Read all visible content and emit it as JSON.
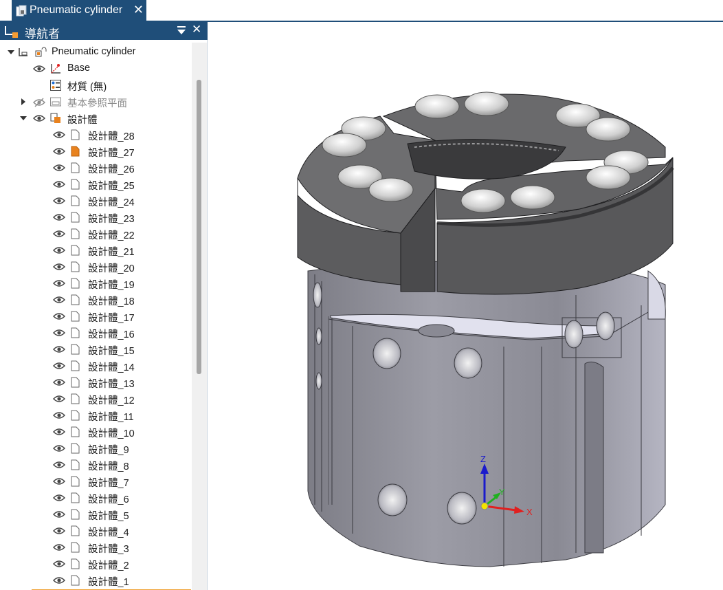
{
  "document_tab": {
    "title": "Pneumatic cylinder",
    "close_glyph": "✕",
    "icon": "part-document-icon"
  },
  "navigator": {
    "title": "導航者",
    "close_glyph": "✕",
    "root": {
      "label": "Pneumatic cylinder"
    },
    "base": {
      "label": "Base"
    },
    "material": {
      "label": "材質 (無)"
    },
    "ref_planes": {
      "label": "基本參照平面"
    },
    "bodies_folder": {
      "label": "設計體"
    },
    "bodies": [
      "設計體_28",
      "設計體_27",
      "設計體_26",
      "設計體_25",
      "設計體_24",
      "設計體_23",
      "設計體_22",
      "設計體_21",
      "設計體_20",
      "設計體_19",
      "設計體_18",
      "設計體_17",
      "設計體_16",
      "設計體_15",
      "設計體_14",
      "設計體_13",
      "設計體_12",
      "設計體_11",
      "設計體_10",
      "設計體_9",
      "設計體_8",
      "設計體_7",
      "設計體_6",
      "設計體_5",
      "設計體_4",
      "設計體_3",
      "設計體_2",
      "設計體_1"
    ],
    "highlighted_body": "設計體_27"
  },
  "viewport": {
    "triad": {
      "x_label": "X",
      "y_label": "Y",
      "z_label": "Z"
    }
  },
  "colors": {
    "accent": "#1f4e79",
    "highlight": "#e8821e",
    "axis_x": "#e02020",
    "axis_y": "#20b020",
    "axis_z": "#1a1acc"
  }
}
